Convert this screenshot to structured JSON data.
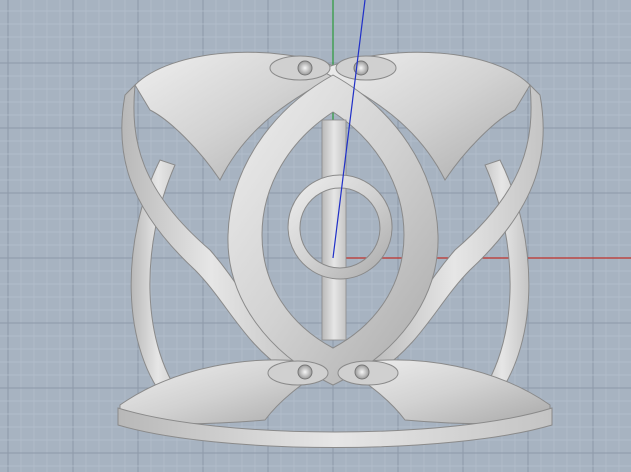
{
  "viewport": {
    "view": "perspective",
    "background_color": "#a7b3c1",
    "grid": {
      "visible": true,
      "minor_color": "#b4bfcc",
      "major_color": "#8e9aa9"
    },
    "axes": {
      "x_color": "#c0302a",
      "y_color": "#2a9a3a",
      "z_color": "#2030c8"
    }
  },
  "model": {
    "name_icon": "cuff-bracelet-3d-model-icon",
    "material_color": "#d5d5d5",
    "shadow_color": "#8a8a8a",
    "highlight_color": "#f4f4f4",
    "gem_settings": 4
  }
}
